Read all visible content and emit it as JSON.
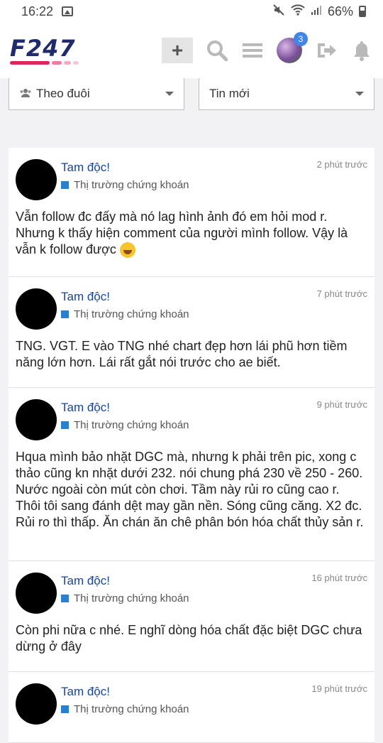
{
  "statusbar": {
    "time": "16:22",
    "battery": "66%"
  },
  "header": {
    "logo": "F247",
    "notification_count": "3"
  },
  "filters": {
    "left_label": "Theo đuôi",
    "right_label": "Tin mới"
  },
  "posts": [
    {
      "author": "Tam độc!",
      "forum": "Thị trường chứng khoán",
      "time": "2 phút trước",
      "content": "Vẫn follow đc đấy mà nó lag hình ảnh đó em hỏi mod r. Nhưng k thấy hiện comment của người mình follow. Vậy là vẫn k follow được",
      "emoji": "rolling-laugh-emoji"
    },
    {
      "author": "Tam độc!",
      "forum": "Thị trường chứng khoán",
      "time": "7 phút trước",
      "content": "TNG. VGT. E vào TNG nhé chart đẹp hơn lái phũ hơn tiềm năng lớn hơn. Lái rất gắt nói trước cho ae biết."
    },
    {
      "author": "Tam độc!",
      "forum": "Thị trường chứng khoán",
      "time": "9 phút trước",
      "content": "Hqua mình bảo nhặt DGC mà, nhưng k phải trên pic, xong c thảo cũng kn nhặt dưới 232. nói chung phá 230 về 250 - 260. Nước ngoài còn mút còn chơi. Tầm này rủi ro cũng cao r. Thôi tôi sang đánh dệt may gần nền. Sóng cũng căng. X2 đc. Rủi ro thì thấp. Ăn chán ăn chê phân bón hóa chất thủy sản r."
    },
    {
      "author": "Tam độc!",
      "forum": "Thị trường chứng khoán",
      "time": "16 phút trước",
      "content": "Còn phi nữa c nhé. E nghĩ dòng hóa chất đặc biệt DGC chưa dừng ở đây"
    },
    {
      "author": "Tam độc!",
      "forum": "Thị trường chứng khoán",
      "time": "19 phút trước",
      "content": ""
    }
  ]
}
